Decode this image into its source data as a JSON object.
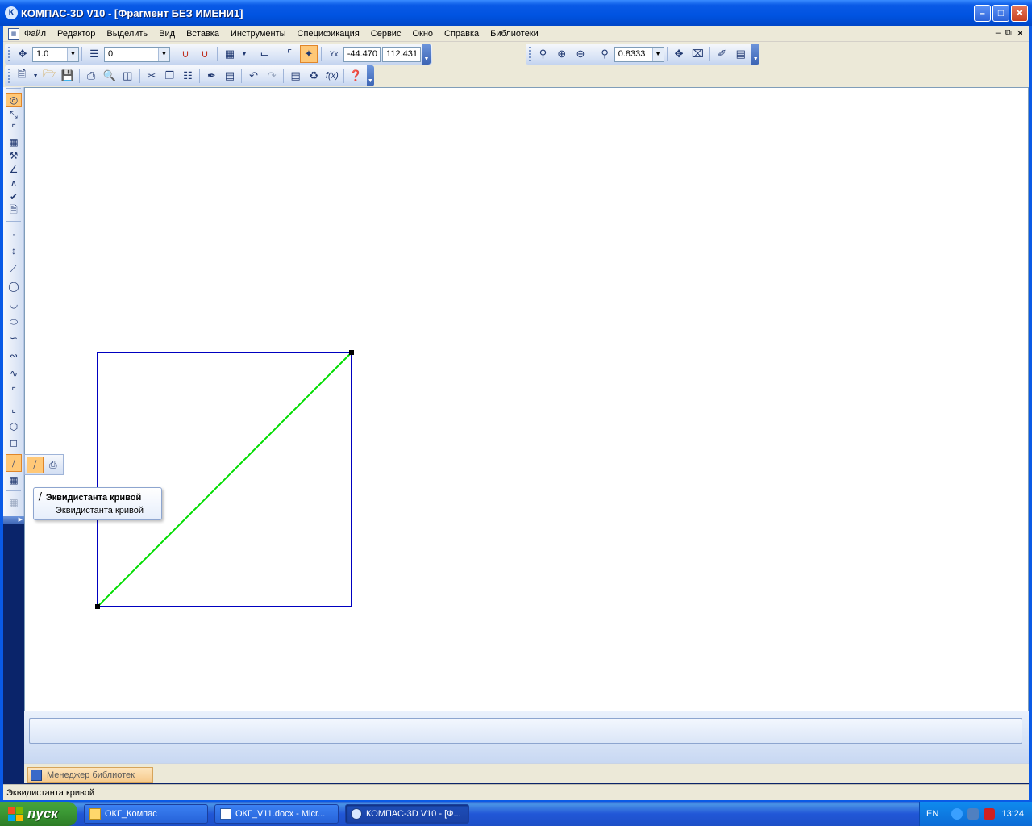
{
  "window": {
    "title": "КОМПАС-3D V10 - [Фрагмент БЕЗ ИМЕНИ1]",
    "app_icon": "К"
  },
  "menu": {
    "items": [
      "Файл",
      "Редактор",
      "Выделить",
      "Вид",
      "Вставка",
      "Инструменты",
      "Спецификация",
      "Сервис",
      "Окно",
      "Справка",
      "Библиотеки"
    ]
  },
  "toolbar_current_state": {
    "step": "1.0",
    "layer": "0",
    "coord_x": "-44.470",
    "coord_y": "112.431"
  },
  "toolbar_view": {
    "zoom": "0.8333"
  },
  "flyout": {
    "tooltip_title": "Эквидистанта кривой",
    "tooltip_body": "Эквидистанта кривой"
  },
  "drawing": {
    "square_color": "#0000c0",
    "diagonal_color": "#00dd00"
  },
  "bottom": {
    "library_tab": "Менеджер библиотек",
    "status_text": "Эквидистанта кривой"
  },
  "taskbar": {
    "start_label": "пуск",
    "items": [
      {
        "label": "ОКГ_Компас"
      },
      {
        "label": "ОКГ_V11.docx - Micr..."
      },
      {
        "label": "КОМПАС-3D V10 - [Ф..."
      }
    ],
    "lang": "EN",
    "clock": "13:24"
  }
}
